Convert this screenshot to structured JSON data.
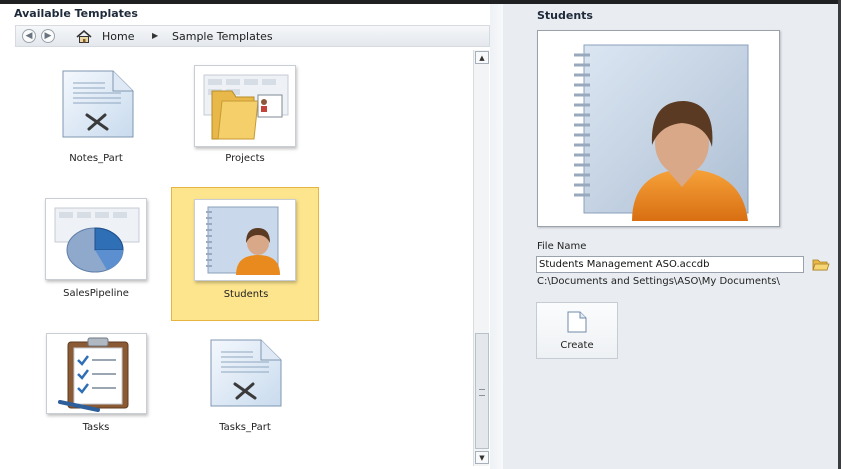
{
  "left_panel": {
    "title": "Available Templates",
    "breadcrumb": {
      "back_icon": "back-arrow-icon",
      "forward_icon": "forward-arrow-icon",
      "home_icon": "home-icon",
      "home": "Home",
      "separator_icon": "breadcrumb-arrow-icon",
      "current": "Sample Templates"
    },
    "templates": [
      {
        "label": "Notes_Part",
        "icon": "notes-document-icon"
      },
      {
        "label": "Projects",
        "icon": "projects-folder-icon"
      },
      {
        "label": "SalesPipeline",
        "icon": "pie-chart-icon"
      },
      {
        "label": "Students",
        "icon": "student-notebook-icon",
        "selected": true
      },
      {
        "label": "Tasks",
        "icon": "clipboard-checklist-icon"
      },
      {
        "label": "Tasks_Part",
        "icon": "document-icon"
      }
    ]
  },
  "right_panel": {
    "title": "Students",
    "preview_icon": "student-notebook-icon",
    "file_name_label": "File Name",
    "file_name_value": "Students Management ASO.accdb",
    "browse_icon": "folder-open-icon",
    "path": "C:\\Documents and Settings\\ASO\\My Documents\\",
    "create_label": "Create",
    "create_icon": "blank-page-icon"
  },
  "colors": {
    "selection_fill": "#fde58e",
    "selection_border": "#e7b440",
    "right_panel_bg": "#e9edf1"
  }
}
